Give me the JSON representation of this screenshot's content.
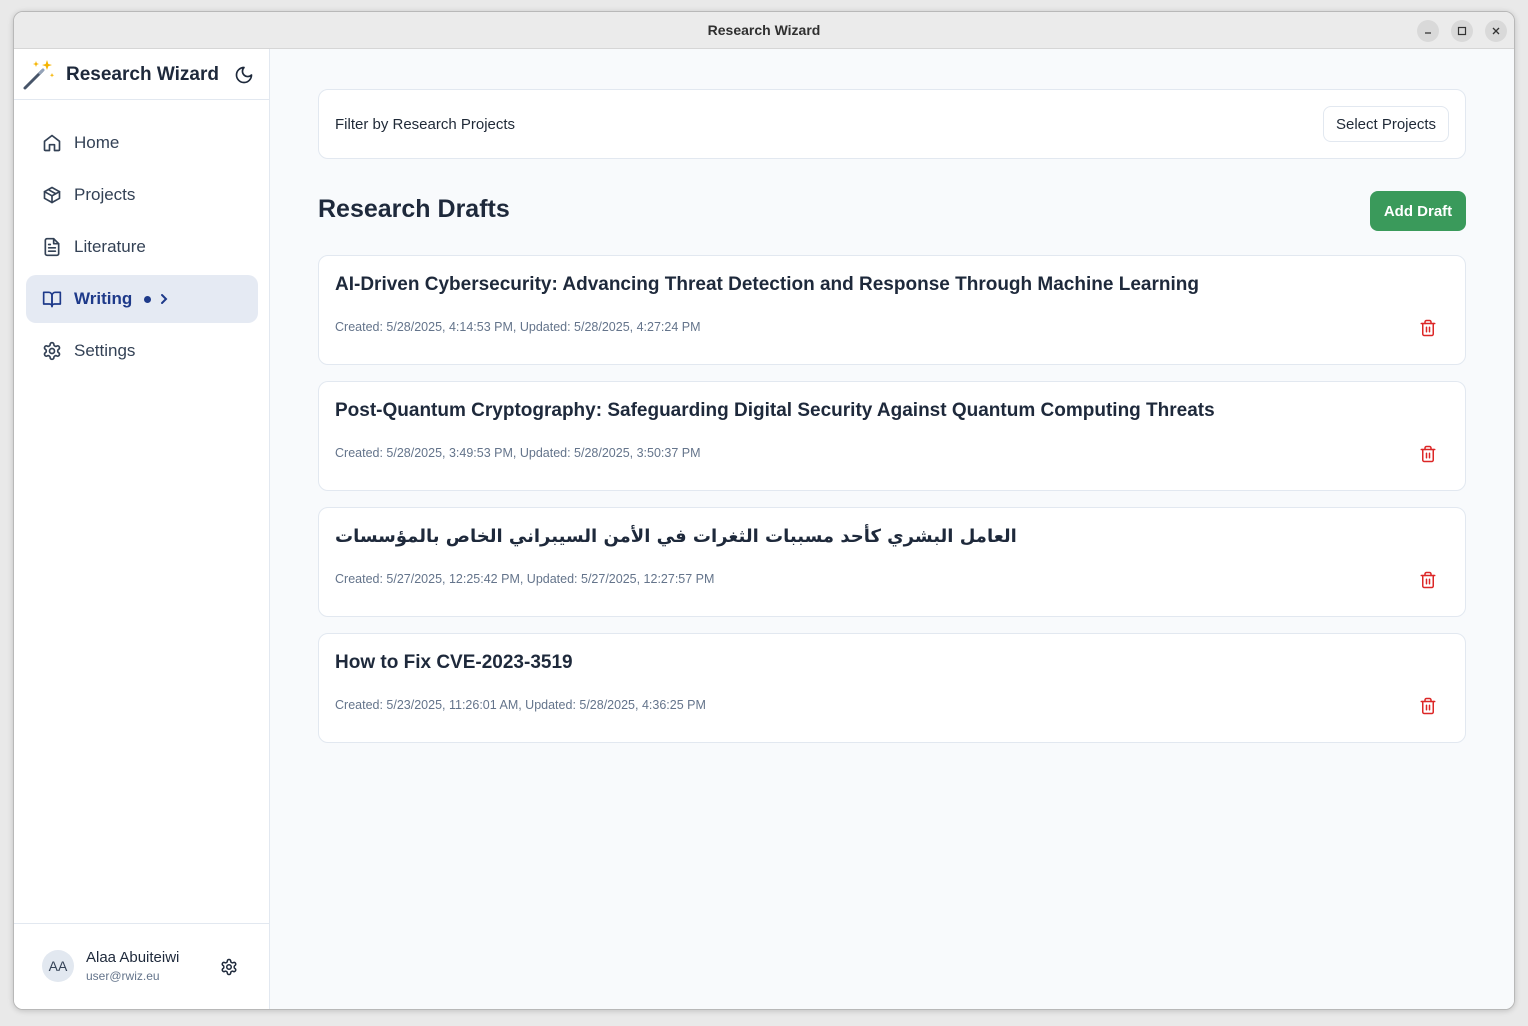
{
  "window": {
    "title": "Research Wizard"
  },
  "sidebar": {
    "app_name": "Research Wizard",
    "items": [
      {
        "label": "Home",
        "icon": "home-icon"
      },
      {
        "label": "Projects",
        "icon": "package-icon"
      },
      {
        "label": "Literature",
        "icon": "file-text-icon"
      },
      {
        "label": "Writing",
        "icon": "book-open-icon",
        "active": true
      },
      {
        "label": "Settings",
        "icon": "gear-icon"
      }
    ],
    "user": {
      "initials": "AA",
      "name": "Alaa Abuiteiwi",
      "email": "user@rwiz.eu"
    }
  },
  "filter": {
    "label": "Filter by Research Projects",
    "button": "Select Projects"
  },
  "drafts_section": {
    "title": "Research Drafts",
    "add_button": "Add Draft"
  },
  "drafts": [
    {
      "title": "AI-Driven Cybersecurity: Advancing Threat Detection and Response Through Machine Learning",
      "meta": "Created: 5/28/2025, 4:14:53 PM, Updated: 5/28/2025, 4:27:24 PM"
    },
    {
      "title": "Post-Quantum Cryptography: Safeguarding Digital Security Against Quantum Computing Threats",
      "meta": "Created: 5/28/2025, 3:49:53 PM, Updated: 5/28/2025, 3:50:37 PM"
    },
    {
      "title": "العامل البشري كأحد مسببات الثغرات في الأمن السيبراني الخاص بالمؤسسات",
      "meta": "Created: 5/27/2025, 12:25:42 PM, Updated: 5/27/2025, 12:27:57 PM"
    },
    {
      "title": "How to Fix CVE-2023-3519",
      "meta": "Created: 5/23/2025, 11:26:01 AM, Updated: 5/28/2025, 4:36:25 PM"
    }
  ],
  "colors": {
    "accent_green": "#3a9a5b",
    "active_nav": "#1e3a8a",
    "delete_red": "#dc2626"
  }
}
